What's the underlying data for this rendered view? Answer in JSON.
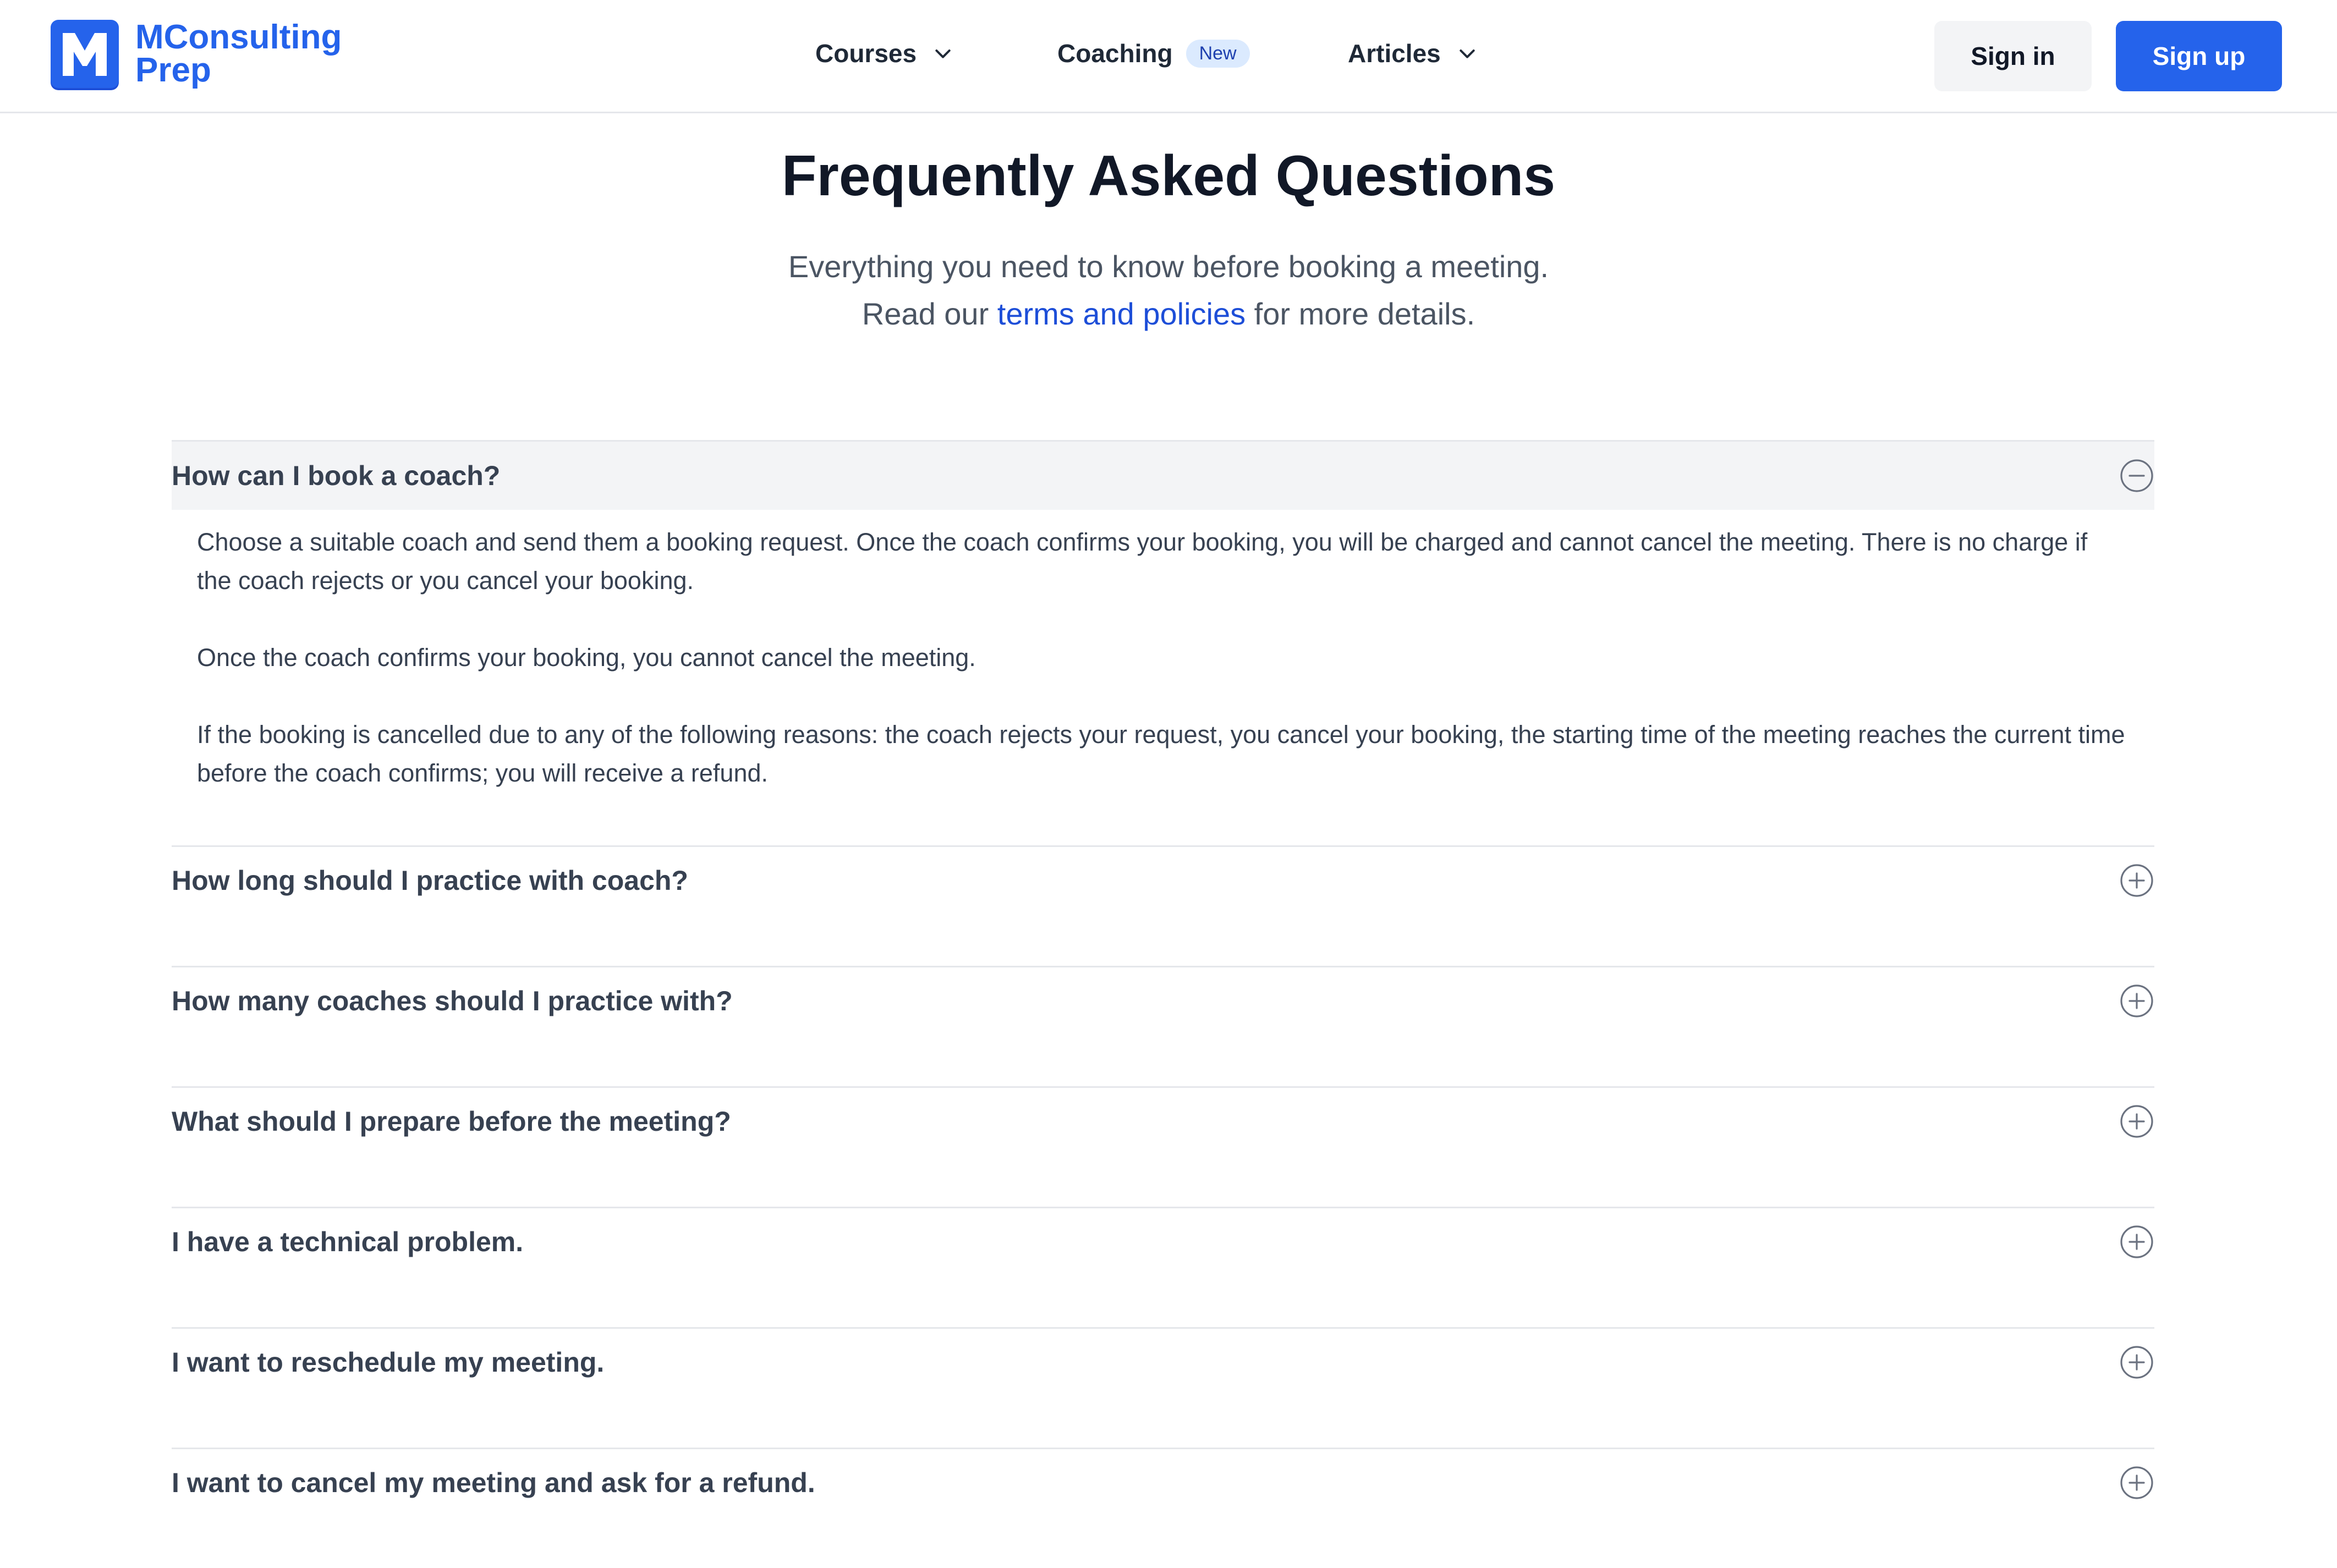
{
  "brand": {
    "line1": "MConsulting",
    "line2": "Prep",
    "color": "#2563eb"
  },
  "nav": {
    "courses": "Courses",
    "coaching": "Coaching",
    "coaching_badge": "New",
    "articles": "Articles"
  },
  "auth": {
    "sign_in": "Sign in",
    "sign_up": "Sign up"
  },
  "hero": {
    "title": "Frequently Asked Questions",
    "line1": "Everything you need to know before booking a meeting.",
    "line2_prefix": "Read our ",
    "line2_link": "terms and policies",
    "line2_suffix": " for more details."
  },
  "faq": [
    {
      "question": "How can I book a coach?",
      "expanded": true,
      "answer": [
        "Choose a suitable coach and send them a booking request. Once the coach confirms your booking, you will be charged and cannot cancel the meeting. There is no charge if the coach rejects or you cancel your booking.",
        "Once the coach confirms your booking, you cannot cancel the meeting.",
        "If the booking is cancelled due to any of the following reasons: the coach rejects your request, you cancel your booking, the starting time of the meeting reaches the current time before the coach confirms; you will receive a refund."
      ]
    },
    {
      "question": "How long should I practice with coach?",
      "expanded": false
    },
    {
      "question": "How many coaches should I practice with?",
      "expanded": false
    },
    {
      "question": "What should I prepare before the meeting?",
      "expanded": false
    },
    {
      "question": "I have a technical problem.",
      "expanded": false
    },
    {
      "question": "I want to reschedule my meeting.",
      "expanded": false
    },
    {
      "question": "I want to cancel my meeting and ask for a refund.",
      "expanded": false
    }
  ]
}
